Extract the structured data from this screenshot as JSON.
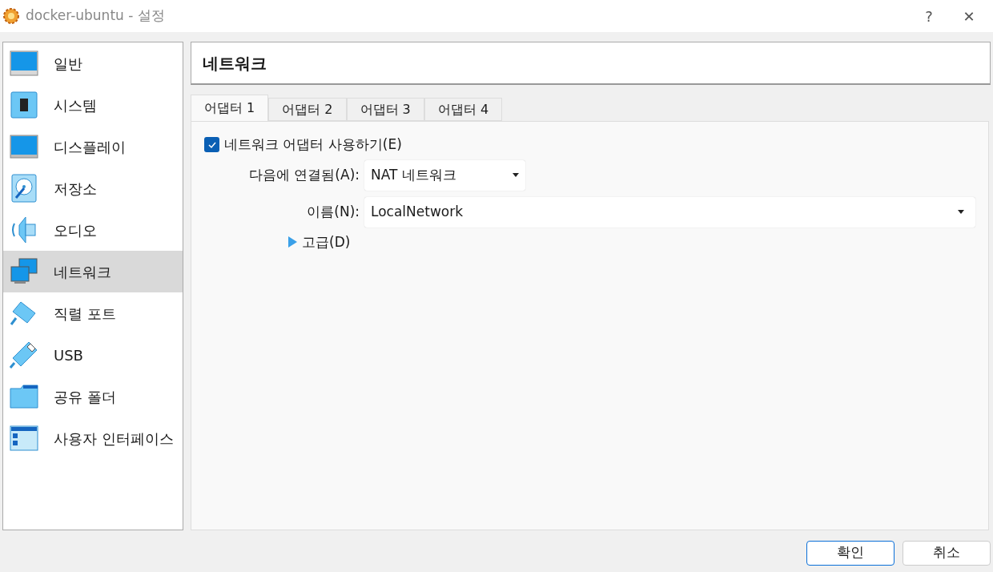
{
  "window": {
    "title": "docker-ubuntu - 설정",
    "help": "?",
    "close": "✕"
  },
  "sidebar": {
    "items": [
      {
        "label": "일반",
        "kind": "general",
        "selected": false
      },
      {
        "label": "시스템",
        "kind": "system",
        "selected": false
      },
      {
        "label": "디스플레이",
        "kind": "display",
        "selected": false
      },
      {
        "label": "저장소",
        "kind": "storage",
        "selected": false
      },
      {
        "label": "오디오",
        "kind": "audio",
        "selected": false
      },
      {
        "label": "네트워크",
        "kind": "network",
        "selected": true
      },
      {
        "label": "직렬 포트",
        "kind": "serial",
        "selected": false
      },
      {
        "label": "USB",
        "kind": "usb",
        "selected": false
      },
      {
        "label": "공유 폴더",
        "kind": "folder",
        "selected": false
      },
      {
        "label": "사용자 인터페이스",
        "kind": "ui",
        "selected": false
      }
    ]
  },
  "page_title": "네트워크",
  "tabs": [
    {
      "label": "어댑터 1",
      "selected": true
    },
    {
      "label": "어댑터 2",
      "selected": false
    },
    {
      "label": "어댑터 3",
      "selected": false
    },
    {
      "label": "어댑터 4",
      "selected": false
    }
  ],
  "enable_adapter": {
    "label": "네트워크 어댑터 사용하기(E)",
    "checked": true
  },
  "attached_to": {
    "label": "다음에 연결됨(A):",
    "value": "NAT 네트워크"
  },
  "name": {
    "label": "이름(N):",
    "value": "LocalNetwork"
  },
  "advanced": {
    "label": "고급(D)",
    "expanded": false
  },
  "buttons": [
    {
      "label": "확인",
      "default": true
    },
    {
      "label": "취소",
      "default": false
    }
  ]
}
